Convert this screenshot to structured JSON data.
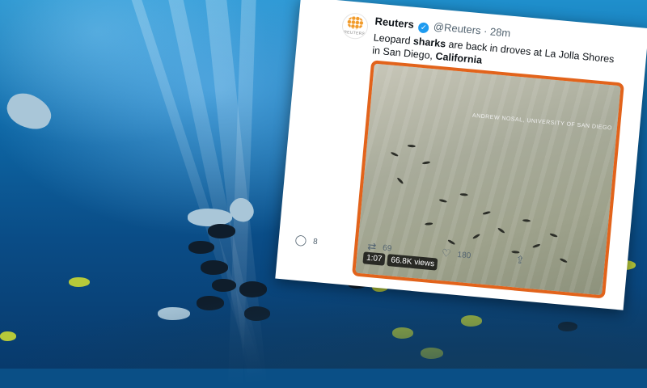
{
  "tweet": {
    "author_name": "Reuters",
    "handle": "@Reuters",
    "separator": "·",
    "time": "28m",
    "avatar_text": "REUTERS",
    "text_prefix": "Leopard ",
    "text_bold_1": "sharks",
    "text_middle": " are back in droves at La Jolla Shores in San Diego, ",
    "text_bold_2": "California",
    "menu_icon": "···",
    "video": {
      "credit": "ANDREW NOSAL, UNIVERSITY OF SAN DIEGO",
      "duration": "1:07",
      "views": "66.8K views"
    },
    "actions": {
      "replies": "8",
      "retweets": "69",
      "likes": "180"
    },
    "colors": {
      "accent_border": "#e2631b",
      "verified": "#1d9bf0"
    }
  }
}
